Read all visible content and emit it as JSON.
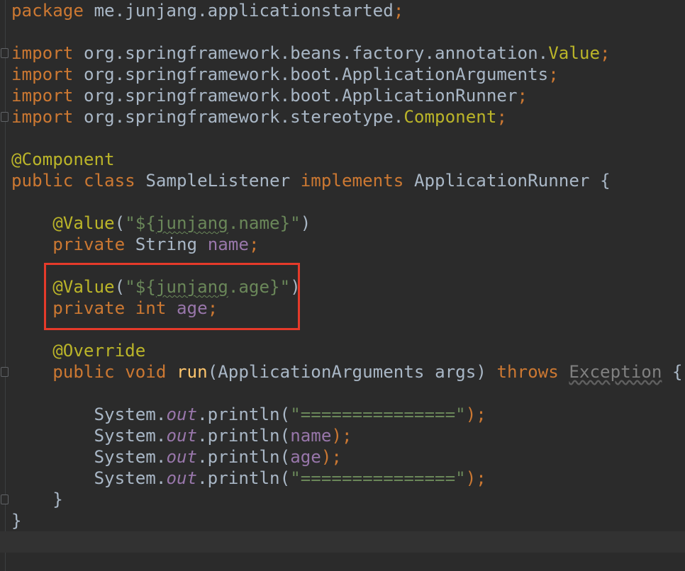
{
  "code": {
    "kw_package": "package",
    "package_name": "me.junjang.applicationstarted",
    "semi": ";",
    "kw_import": "import",
    "imp1_prefix": "org.springframework.beans.factory.annotation.",
    "imp1_class": "Value",
    "imp2_path": "org.springframework.boot.ApplicationArguments",
    "imp3_path": "org.springframework.boot.ApplicationRunner",
    "imp4_prefix": "org.springframework.stereotype.",
    "imp4_class": "Component",
    "ann_component": "@Component",
    "kw_public": "public",
    "kw_class": "class",
    "class_name": "SampleListener",
    "kw_implements": "implements",
    "iface": "ApplicationRunner",
    "open_brace": "{",
    "close_brace": "}",
    "ann_value": "@Value",
    "paren_open": "(",
    "paren_close": ")",
    "str_name_pre": "\"${",
    "str_name_word": "junjang",
    "str_name_post": ".name}\"",
    "kw_private": "private",
    "type_string": "String",
    "field_name": "name",
    "str_age_pre": "\"${",
    "str_age_word": "junjang",
    "str_age_post": ".age}\"",
    "kw_int": "int",
    "field_age": "age",
    "ann_override": "@Override",
    "kw_void": "void",
    "method_run": "run",
    "param_type": "ApplicationArguments",
    "param_name": "args",
    "kw_throws": "throws",
    "exception": "Exception",
    "sys": "System.",
    "out": "out",
    "println": ".println(",
    "str_sep": "\"===============\"",
    "stmt_end": ");"
  }
}
